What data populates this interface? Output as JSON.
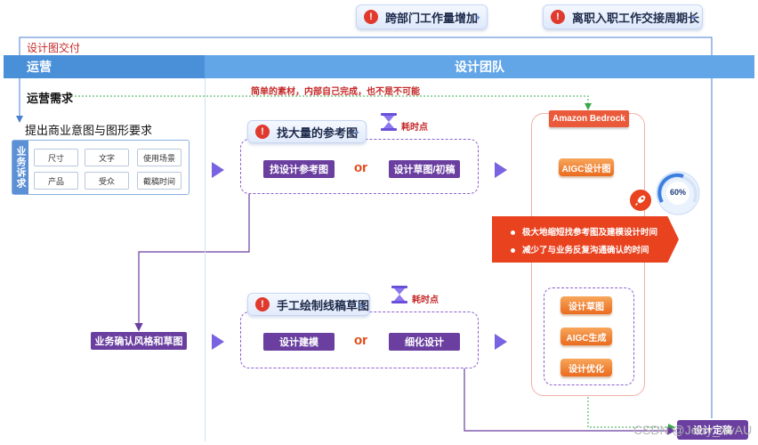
{
  "alerts": [
    {
      "text": "跨部门工作量增加"
    },
    {
      "text": "离职入职工作交接周期长"
    }
  ],
  "delivery_label": "设计图交付",
  "band": {
    "left": "运营",
    "right": "设计团队"
  },
  "ops_demand": "运营需求",
  "note": "简单的素材，内部自己完成，也不是不可能",
  "request_label": "提出商业意图与图形要求",
  "appeal": {
    "side_label": "业务诉求",
    "items": [
      "尺寸",
      "文字",
      "使用场景",
      "产品",
      "受众",
      "截稿时间"
    ]
  },
  "card_top": {
    "title": "找大量的参考图",
    "option_a": "找设计参考图",
    "or": "or",
    "option_b": "设计草图/初稿",
    "time_label": "耗时点"
  },
  "card_bottom": {
    "title": "手工绘制线稿草图",
    "option_a": "设计建模",
    "or": "or",
    "option_b": "细化设计",
    "time_label": "耗时点"
  },
  "confirm_label": "业务确认风格和草图",
  "bedrock": {
    "tag": "Amazon Bedrock",
    "aigc_top": "AIGC设计图",
    "steps": [
      "设计草图",
      "AIGC生成",
      "设计优化"
    ]
  },
  "benefits": [
    "极大地缩短找参考图及建模设计时间",
    "减少了与业务反复沟通确认的时间"
  ],
  "gauge": {
    "value": "60%"
  },
  "final_label": "设计定稿",
  "watermark": "CSDN @Jerry_wvAU",
  "colors": {
    "purple": "#6a3fa0",
    "orange": "#ea6b1e",
    "red": "#e8421f",
    "blue": "#4a90d9"
  },
  "icons": [
    "alert-icon",
    "hourglass-icon",
    "rocket-icon",
    "gauge-icon"
  ]
}
